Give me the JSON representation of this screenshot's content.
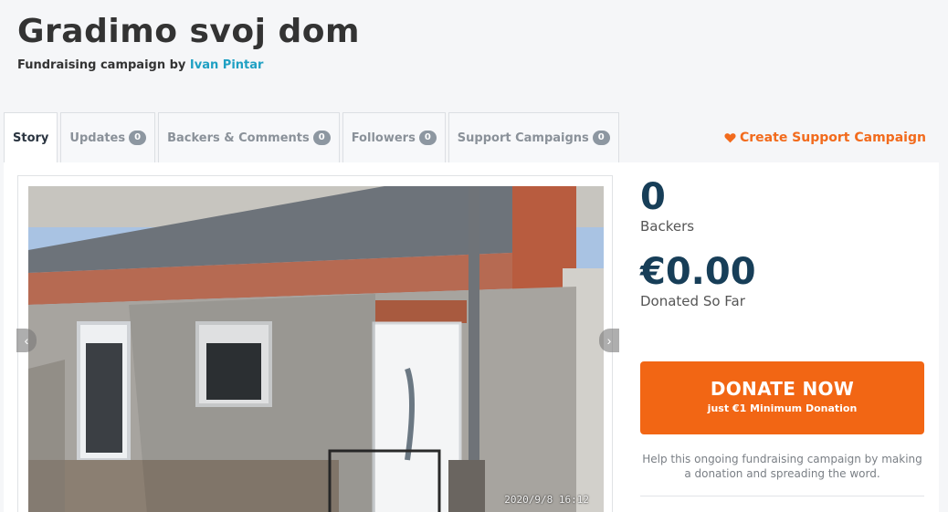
{
  "page": {
    "title": "Gradimo svoj dom",
    "subtitle_prefix": "Fundraising campaign by ",
    "author": "Ivan Pintar"
  },
  "tabs": [
    {
      "label": "Story",
      "active": true
    },
    {
      "label": "Updates",
      "count": "0"
    },
    {
      "label": "Backers & Comments",
      "count": "0"
    },
    {
      "label": "Followers",
      "count": "0"
    },
    {
      "label": "Support Campaigns",
      "count": "0"
    }
  ],
  "support_link": {
    "label": "Create Support Campaign",
    "icon": "heart-icon"
  },
  "gallery": {
    "timestamp": "2020/9/8 16:12"
  },
  "stats": {
    "backers_count": "0",
    "backers_label": "Backers",
    "donated_amount": "€0.00",
    "donated_label": "Donated So Far"
  },
  "donate": {
    "label": "DONATE NOW",
    "sublabel": "just €1 Minimum Donation"
  },
  "help_text": "Help this ongoing fundraising campaign by making a donation and spreading the word.",
  "colors": {
    "accent": "#f26614",
    "link": "#1fa0c3",
    "stat": "#173e58"
  }
}
